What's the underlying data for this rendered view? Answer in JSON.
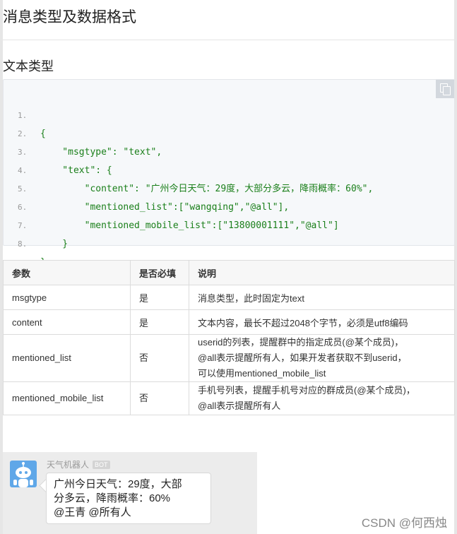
{
  "page": {
    "title": "消息类型及数据格式",
    "section_title": "文本类型"
  },
  "code_block": {
    "lines": [
      {
        "num": "1.",
        "text": "{"
      },
      {
        "num": "2.",
        "text": "    \"msgtype\": \"text\","
      },
      {
        "num": "3.",
        "text": "    \"text\": {"
      },
      {
        "num": "4.",
        "text": "        \"content\": \"广州今日天气：29度，大部分多云，降雨概率：60%\","
      },
      {
        "num": "5.",
        "text": "        \"mentioned_list\":[\"wangqing\",\"@all\"],"
      },
      {
        "num": "6.",
        "text": "        \"mentioned_mobile_list\":[\"13800001111\",\"@all\"]"
      },
      {
        "num": "7.",
        "text": "    }"
      },
      {
        "num": "8.",
        "text": "}"
      }
    ],
    "copy_icon": "copy-icon"
  },
  "table": {
    "headers": [
      "参数",
      "是否必填",
      "说明"
    ],
    "rows": [
      {
        "param": "msgtype",
        "required": "是",
        "desc": [
          "消息类型，此时固定为text"
        ]
      },
      {
        "param": "content",
        "required": "是",
        "desc": [
          "文本内容，最长不超过2048个字节，必须是utf8编码"
        ]
      },
      {
        "param": "mentioned_list",
        "required": "否",
        "desc": [
          "userid的列表，提醒群中的指定成员(@某个成员)，",
          "@all表示提醒所有人，如果开发者获取不到userid，",
          "可以使用mentioned_mobile_list"
        ]
      },
      {
        "param": "mentioned_mobile_list",
        "required": "否",
        "desc": [
          "手机号列表，提醒手机号对应的群成员(@某个成员)，",
          "@all表示提醒所有人"
        ]
      }
    ]
  },
  "chat_preview": {
    "bot_name": "天气机器人",
    "badge": "BOT",
    "message_lines": [
      "广州今日天气：29度，大部",
      "分多云，降雨概率：60%",
      "@王青 @所有人"
    ],
    "avatar_icon": "robot-avatar-icon"
  },
  "watermark": "CSDN @何西烛",
  "colors": {
    "code_text": "#1a7f1a",
    "avatar_blue": "#5fa7e8"
  }
}
